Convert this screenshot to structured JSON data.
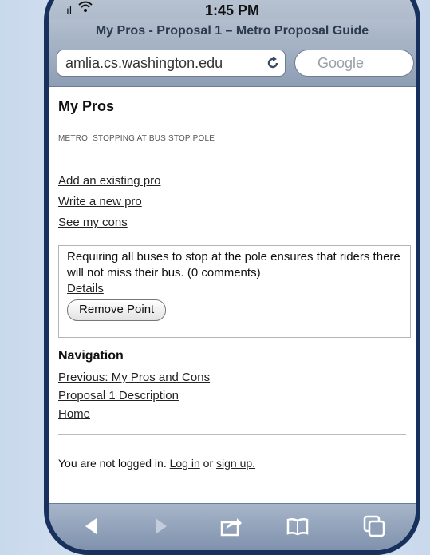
{
  "status_bar": {
    "time": "1:45 PM"
  },
  "browser": {
    "title": "My Pros - Proposal 1 – Metro Proposal Guide",
    "url": "amlia.cs.washington.edu",
    "search_placeholder": "Google"
  },
  "page": {
    "title": "My Pros",
    "breadcrumb": "Metro: Stopping at Bus Stop Pole",
    "links": {
      "add_existing": "Add an existing pro",
      "write_new": "Write a new pro",
      "see_cons": "See my cons"
    },
    "point": {
      "text": "Requiring all buses to stop at the pole ensures that riders there will not miss their bus. (0 comments)",
      "details_label": "Details",
      "remove_label": "Remove Point"
    },
    "navigation": {
      "heading": "Navigation",
      "previous": "Previous: My Pros and Cons",
      "description": "Proposal 1 Description",
      "home": "Home"
    },
    "login": {
      "prefix": "You are not logged in.",
      "login_label": "Log in",
      "or": "or",
      "signup_label": "sign up."
    }
  },
  "toolbar": {
    "icons": [
      "back-icon",
      "forward-icon",
      "share-icon",
      "bookmarks-icon",
      "tabs-icon"
    ]
  }
}
